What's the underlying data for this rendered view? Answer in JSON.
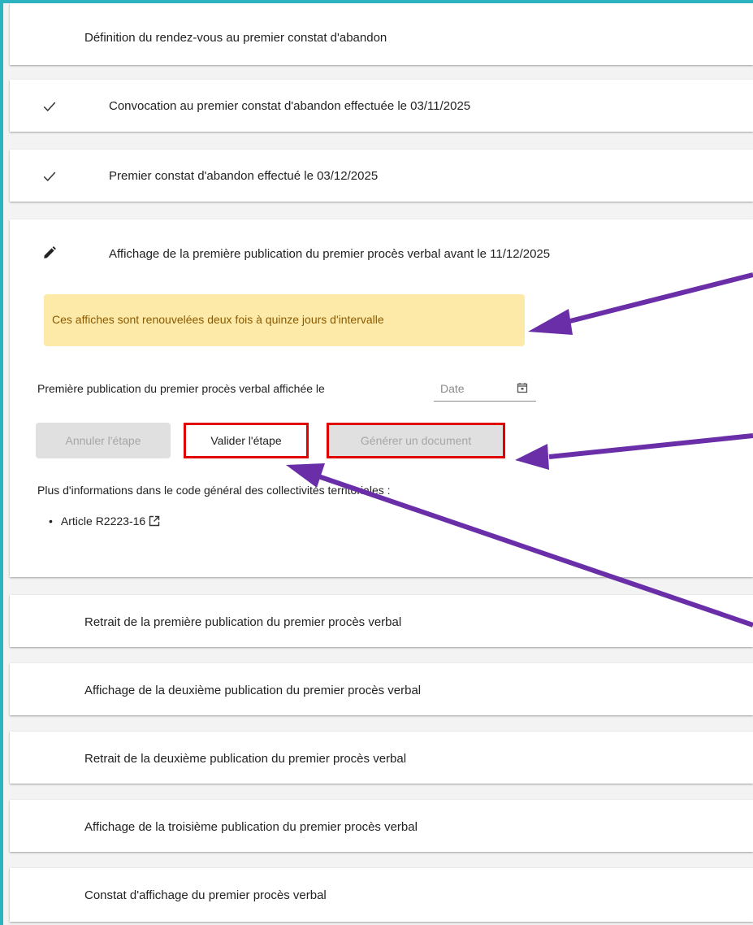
{
  "steps": {
    "s1": {
      "title": "Définition du rendez-vous au premier constat d'abandon",
      "status": "pending"
    },
    "s2": {
      "title": "Convocation au premier constat d'abandon effectuée le 03/11/2025",
      "status": "done",
      "icon": "check-icon"
    },
    "s3": {
      "title": "Premier constat d'abandon effectué le 03/12/2025",
      "status": "done",
      "icon": "check-icon"
    },
    "s4": {
      "title": "Affichage de la première publication du premier procès verbal avant le 11/12/2025",
      "status": "in-progress",
      "icon": "pencil-icon",
      "alert": "Ces affiches sont renouvelées deux fois à quinze jours d'intervalle",
      "date_label": "Première publication du premier procès verbal affichée le",
      "date_placeholder": "Date",
      "date_value": "",
      "buttons": {
        "cancel": "Annuler l'étape",
        "validate": "Valider l'étape",
        "generate": "Générer un document"
      },
      "more_info": "Plus d'informations dans le code général des collectivités territoriales :",
      "article": "Article R2223-16"
    },
    "s5": {
      "title": "Retrait de la première publication du premier procès verbal",
      "status": "pending"
    },
    "s6": {
      "title": "Affichage de la deuxième publication du premier procès verbal",
      "status": "pending"
    },
    "s7": {
      "title": "Retrait de la deuxième publication du premier procès verbal",
      "status": "pending"
    },
    "s8": {
      "title": "Affichage de la troisième publication du premier procès verbal",
      "status": "pending"
    },
    "s9": {
      "title": "Constat d'affichage du premier procès verbal",
      "status": "pending"
    }
  },
  "colors": {
    "frame": "#2bb3c0",
    "alert_bg": "#fdeaa8",
    "alert_text": "#8a5a00",
    "annotation_arrow": "#6a2fa8",
    "highlight_box": "#e00000"
  }
}
